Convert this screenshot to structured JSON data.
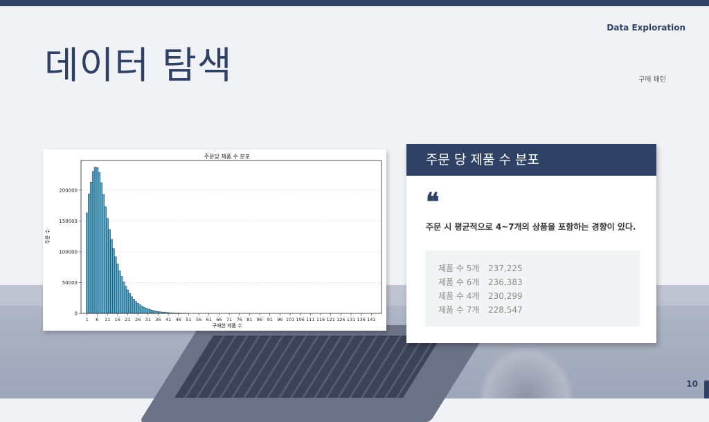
{
  "slide": {
    "title": "데이터 탐색",
    "section_label": "Data Exploration",
    "sub_label": "구매 패턴",
    "page_number": "10"
  },
  "info_card": {
    "header": "주문 당 제품 수 분포",
    "quote_icon": "❝",
    "text": "주문 시 평균적으로 4~7개의 상품을 포함하는 경향이 있다.",
    "stats": [
      {
        "label": "제품 수 5개",
        "value": "237,225"
      },
      {
        "label": "제품 수 6개",
        "value": "236,383"
      },
      {
        "label": "제품 수 4개",
        "value": "230,299"
      },
      {
        "label": "제품 수 7개",
        "value": "228,547"
      }
    ]
  },
  "colors": {
    "accent": "#2f4266",
    "bar_fill": "#5aafd0",
    "bar_edge": "#1c2a3a"
  },
  "chart_data": {
    "type": "bar",
    "title": "주문당 제품 수 분포",
    "xlabel": "구매한 제품 수",
    "ylabel": "주문 수",
    "xticks": [
      1,
      6,
      11,
      16,
      21,
      26,
      31,
      36,
      41,
      46,
      51,
      56,
      61,
      66,
      71,
      76,
      81,
      86,
      91,
      96,
      101,
      106,
      111,
      116,
      121,
      126,
      131,
      136,
      141
    ],
    "yticks": [
      0,
      50000,
      100000,
      150000,
      200000
    ],
    "ylim": [
      0,
      248000
    ],
    "xlim": [
      -2,
      146
    ],
    "grid": true,
    "x": [
      1,
      2,
      3,
      4,
      5,
      6,
      7,
      8,
      9,
      10,
      11,
      12,
      13,
      14,
      15,
      16,
      17,
      18,
      19,
      20,
      21,
      22,
      23,
      24,
      25,
      26,
      27,
      28,
      29,
      30,
      31,
      32,
      33,
      34,
      35,
      36,
      37,
      38,
      39,
      40,
      41,
      42,
      43,
      44,
      45,
      46,
      47,
      48,
      49,
      50
    ],
    "values": [
      163000,
      194000,
      213000,
      230299,
      237225,
      236383,
      228547,
      212000,
      193000,
      173000,
      154000,
      136000,
      120000,
      105000,
      92000,
      80000,
      69000,
      60000,
      51000,
      44000,
      38000,
      32000,
      27000,
      23000,
      19500,
      16500,
      14000,
      11800,
      10000,
      8500,
      7200,
      6100,
      5100,
      4300,
      3600,
      3000,
      2500,
      2100,
      1800,
      1500,
      1250,
      1050,
      880,
      740,
      620,
      520,
      440,
      370,
      310,
      260
    ]
  }
}
